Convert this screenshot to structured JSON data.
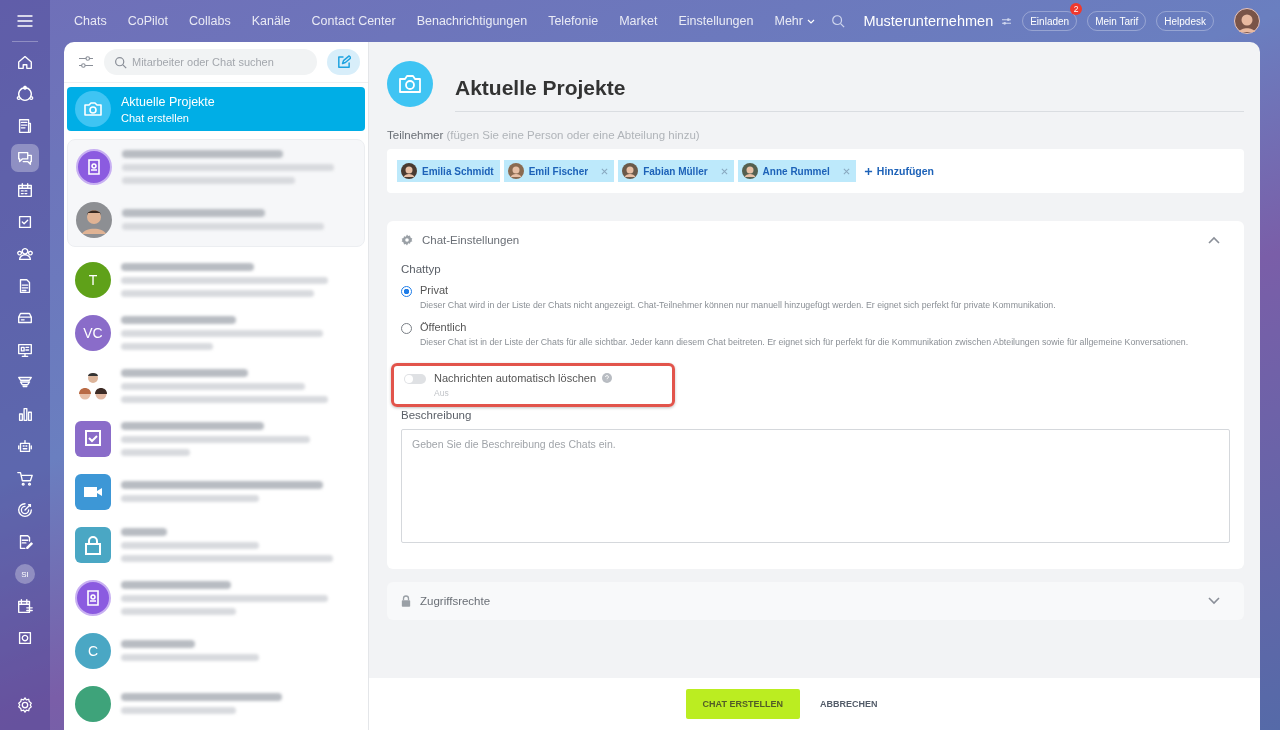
{
  "top_nav": {
    "items": [
      {
        "label": "Chats"
      },
      {
        "label": "CoPilot"
      },
      {
        "label": "Collabs"
      },
      {
        "label": "Kanäle"
      },
      {
        "label": "Contact Center"
      },
      {
        "label": "Benachrichtigungen"
      },
      {
        "label": "Telefonie"
      },
      {
        "label": "Market"
      },
      {
        "label": "Einstellungen"
      },
      {
        "label": "Mehr",
        "dropdown": true
      }
    ],
    "company": "Musterunternehmen",
    "buttons": [
      {
        "label": "Einladen",
        "badge": "2"
      },
      {
        "label": "Mein Tarif"
      },
      {
        "label": "Helpdesk"
      }
    ]
  },
  "rail": {
    "items": [
      {
        "kind": "icon",
        "selected": false
      },
      {
        "kind": "icon",
        "selected": false
      },
      {
        "kind": "icon",
        "selected": false
      },
      {
        "kind": "icon",
        "selected": true
      },
      {
        "kind": "icon",
        "selected": false
      },
      {
        "kind": "icon",
        "selected": false
      },
      {
        "kind": "icon",
        "selected": false
      },
      {
        "kind": "icon",
        "selected": false
      },
      {
        "kind": "icon",
        "selected": false
      },
      {
        "kind": "icon",
        "selected": false
      },
      {
        "kind": "icon",
        "selected": false
      },
      {
        "kind": "icon",
        "selected": false
      },
      {
        "kind": "icon",
        "selected": false
      },
      {
        "kind": "icon",
        "selected": false
      },
      {
        "kind": "icon",
        "selected": false
      },
      {
        "kind": "icon",
        "selected": false
      },
      {
        "kind": "avatar",
        "text": "SI",
        "selected": false
      },
      {
        "kind": "icon",
        "selected": false
      },
      {
        "kind": "icon",
        "selected": false
      }
    ]
  },
  "chat_panel": {
    "search": {
      "placeholder": "Mitarbeiter oder Chat suchen"
    },
    "new_chat": {
      "title": "Aktuelle Projekte",
      "subtitle": "Chat erstellen",
      "selected": true
    },
    "chats": [
      {
        "kind": "round-icon",
        "color": "#8b5be0",
        "pinned": true
      },
      {
        "kind": "photo",
        "pinned": true
      },
      {
        "kind": "initials",
        "text": "T",
        "color": "#5fa119",
        "pinned": false
      },
      {
        "kind": "initials",
        "text": "VC",
        "color": "#8a6cc9",
        "pinned": false
      },
      {
        "kind": "group",
        "pinned": false
      },
      {
        "kind": "square-icon",
        "color": "#8a6cc9",
        "pinned": false
      },
      {
        "kind": "square-icon",
        "color": "#3d97d6",
        "pinned": false
      },
      {
        "kind": "square-icon",
        "color": "#4aa7c4",
        "pinned": false
      },
      {
        "kind": "round-icon",
        "color": "#8b5be0",
        "pinned": false
      },
      {
        "kind": "initials",
        "text": "C",
        "color": "#4aa7c4",
        "pinned": false
      },
      {
        "kind": "initials",
        "color": "#3ea37a",
        "pinned": false
      }
    ]
  },
  "form": {
    "title": "Aktuelle Projekte",
    "participants": {
      "label": "Teilnehmer",
      "hint": "(fügen Sie eine Person oder eine Abteilung hinzu)",
      "people": [
        {
          "name": "Emilia Schmidt",
          "removable": false
        },
        {
          "name": "Emil Fischer",
          "removable": true
        },
        {
          "name": "Fabian Müller",
          "removable": true
        },
        {
          "name": "Anne Rummel",
          "removable": true
        }
      ],
      "add": "Hinzufügen"
    },
    "sections": [
      {
        "title": "Chat-Einstellungen",
        "kind": "settings",
        "expanded": true
      },
      {
        "title": "Zugriffsrechte",
        "kind": "access",
        "expanded": false
      }
    ],
    "chat_type": {
      "label": "Chattyp",
      "options": [
        {
          "label": "Privat",
          "description": "Dieser Chat wird in der Liste der Chats nicht angezeigt. Chat-Teilnehmer können nur manuell hinzugefügt werden. Er eignet sich perfekt für private Kommunikation.",
          "selected": true
        },
        {
          "label": "Öffentlich",
          "description": "Dieser Chat ist in der Liste der Chats für alle sichtbar. Jeder kann diesem Chat beitreten. Er eignet sich für perfekt für die Kommunikation zwischen Abteilungen sowie für allgemeine Konversationen.",
          "selected": false
        }
      ]
    },
    "auto_delete": {
      "label": "Nachrichten automatisch löschen",
      "state": "Aus",
      "on": false,
      "highlighted": true
    },
    "description": {
      "label": "Beschreibung",
      "placeholder": "Geben Sie die Beschreibung des Chats ein."
    }
  },
  "footer": {
    "create": "CHAT ERSTELLEN",
    "cancel": "ABBRECHEN"
  }
}
